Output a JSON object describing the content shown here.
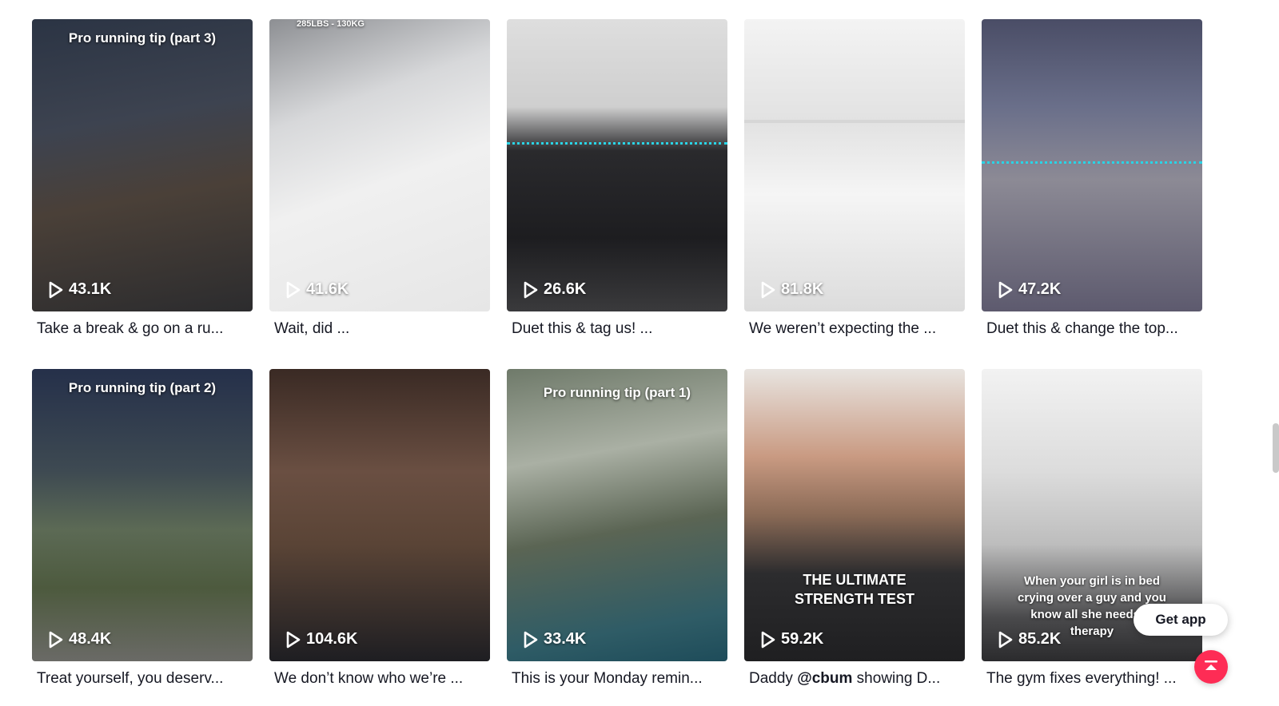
{
  "videos": [
    {
      "top_text": "Pro running tip (part 3)",
      "views": "43.1K",
      "caption": "Take a break & go on a ru...",
      "bg": "linear-gradient(170deg,#2b3444 0%,#3d4350 35%,#4a4038 60%,#2c2c2e 100%)",
      "scan": ""
    },
    {
      "top_text": "285LBS - 130KG",
      "views": "41.6K",
      "caption": "Wait, did ...",
      "bg": "linear-gradient(160deg,#8d8f93 0%,#d7d8da 30%,#f0f0f0 55%,#e6e6e6 100%)",
      "scan": ""
    },
    {
      "top_text": "",
      "views": "26.6K",
      "caption": "Duet this & tag us! ...",
      "bg": "linear-gradient(180deg,#dedede 0%,#cfcfcf 30%,#2a2a2d 45%,#1d1d20 75%,#3a3a3c 100%)",
      "scan": "yes"
    },
    {
      "top_text": "",
      "views": "81.8K",
      "caption": "We weren’t expecting the ...",
      "bg": "linear-gradient(180deg,#f3f3f3 0%,#e2e2e2 35%,#f5f5f5 60%,#dcdcdc 100%)",
      "scan": "yes"
    },
    {
      "top_text": "",
      "views": "47.2K",
      "caption": "Duet this & change the top...",
      "bg": "linear-gradient(180deg,#4a4d66 0%,#6a6f8a 30%,#8c8a95 55%,#5d5a6e 100%)",
      "scan": "yes"
    },
    {
      "top_text": "Pro running tip (part 2)",
      "views": "48.4K",
      "caption": "Treat yourself, you deserv...",
      "bg": "linear-gradient(180deg,#25304a 0%,#3e4a52 35%,#5c6a55 55%,#4d5a3e 75%,#6a6a66 100%)",
      "scan": ""
    },
    {
      "top_text": "",
      "views": "104.6K",
      "caption": "We don’t know who we’re ...",
      "bg": "linear-gradient(180deg,#3a2a24 0%,#6a4f42 35%,#5a4436 60%,#1e1e22 100%)",
      "scan": ""
    },
    {
      "top_text": "Pro running tip (part 1)",
      "views": "33.4K",
      "caption": "This is your Monday remin...",
      "bg": "linear-gradient(170deg,#6f7a6a 0%,#aab0a4 30%,#5b6554 55%,#2f5c66 85%,#1e4c5a 100%)",
      "scan": ""
    },
    {
      "top_text": "",
      "mid_text": [
        "THE ULTIMATE",
        "STRENGTH TEST"
      ],
      "views": "59.2K",
      "caption_prefix": "Daddy ",
      "caption_mention": "@cbum",
      "caption_suffix": " showing D...",
      "bg": "linear-gradient(180deg,#e8e4e0 0%,#c99a82 30%,#8a6a56 50%,#2c2c2e 70%,#1f1f21 100%)",
      "scan": ""
    },
    {
      "top_text": "",
      "mid_text": [
        "When your girl is in bed",
        "crying over a guy and you",
        "know all she needs is",
        "therapy"
      ],
      "views": "85.2K",
      "caption": "The gym fixes everything! ...",
      "bg": "linear-gradient(180deg,#f2f2f2 0%,#dcdcdc 35%,#bdbdbd 60%,#4a4a4c 85%,#2b2b2d 100%)",
      "scan": ""
    }
  ],
  "floating": {
    "get_app": "Get app"
  },
  "colors": {
    "accent": "#fe2c55",
    "scanline": "#2ad4e6",
    "text": "#161823"
  }
}
